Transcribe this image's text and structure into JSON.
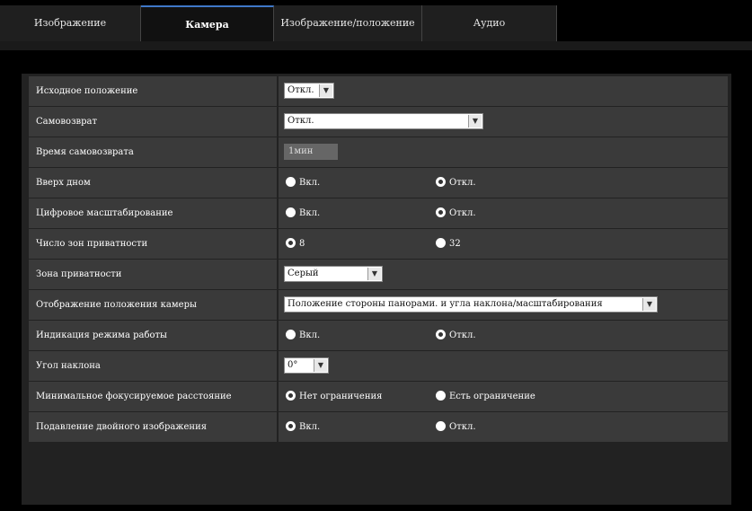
{
  "tabs": [
    {
      "label": "Изображение"
    },
    {
      "label": "Камера"
    },
    {
      "label": "Изображение/положение"
    },
    {
      "label": "Аудио"
    }
  ],
  "settings": [
    {
      "label": "Исходное положение",
      "control": "select",
      "value": "Откл."
    },
    {
      "label": "Самовозврат",
      "control": "select",
      "value": "Откл."
    },
    {
      "label": "Время самовозврата",
      "control": "button",
      "value": "1мин"
    },
    {
      "label": "Вверх дном",
      "control": "radio",
      "options": [
        "Вкл.",
        "Откл."
      ],
      "selected": 1
    },
    {
      "label": "Цифровое масштабирование",
      "control": "radio",
      "options": [
        "Вкл.",
        "Откл."
      ],
      "selected": 1
    },
    {
      "label": "Число зон приватности",
      "control": "radio",
      "options": [
        "8",
        "32"
      ],
      "selected": 0
    },
    {
      "label": "Зона приватности",
      "control": "select",
      "value": "Серый"
    },
    {
      "label": "Отображение положения камеры",
      "control": "select",
      "value": "Положение стороны панорами. и угла наклона/масштабирования"
    },
    {
      "label": "Индикация режима работы",
      "control": "radio",
      "options": [
        "Вкл.",
        "Откл."
      ],
      "selected": 1
    },
    {
      "label": "Угол наклона",
      "control": "select",
      "value": "0°"
    },
    {
      "label": "Минимальное фокусируемое расстояние",
      "control": "radio",
      "options": [
        "Нет ограничения",
        "Есть ограничение"
      ],
      "selected": 0
    },
    {
      "label": "Подавление двойного изображения",
      "control": "radio",
      "options": [
        "Вкл.",
        "Откл."
      ],
      "selected": 0
    }
  ]
}
